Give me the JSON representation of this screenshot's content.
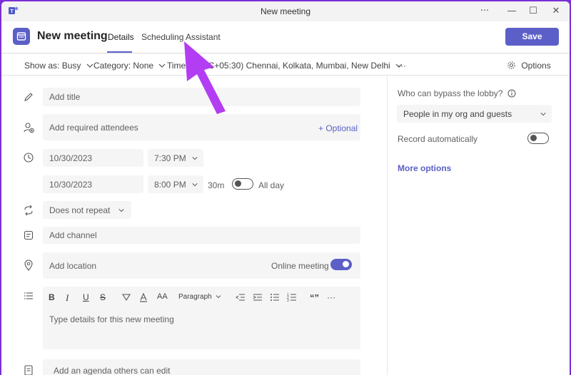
{
  "window": {
    "title": "New meeting",
    "controls": {
      "more": "···",
      "minimize": "—",
      "maximize": "☐",
      "close": "✕"
    }
  },
  "header": {
    "title": "New meeting",
    "tabs": [
      {
        "label": "Details",
        "active": true
      },
      {
        "label": "Scheduling Assistant",
        "active": false
      }
    ],
    "save_label": "Save"
  },
  "toolbar": {
    "show_as": "Show as: Busy",
    "category": "Category: None",
    "time_zone_prefix": "Time",
    "time_zone": "(UTC+05:30) Chennai, Kolkata, Mumbai, New Delhi",
    "more": "···",
    "options": "Options"
  },
  "form": {
    "title_placeholder": "Add title",
    "attendees_placeholder": "Add required attendees",
    "optional_link": "+ Optional",
    "start_date": "10/30/2023",
    "start_time": "7:30 PM",
    "end_date": "10/30/2023",
    "end_time": "8:00 PM",
    "duration": "30m",
    "all_day_label": "All day",
    "all_day_on": false,
    "repeat": "Does not repeat",
    "channel_placeholder": "Add channel",
    "location_placeholder": "Add location",
    "online_meeting_label": "Online meeting",
    "online_meeting_on": true,
    "paragraph_label": "Paragraph",
    "details_placeholder": "Type details for this new meeting",
    "agenda_placeholder": "Add an agenda others can edit"
  },
  "formatting": [
    "B",
    "I",
    "U",
    "S",
    "AA",
    "“”",
    "···"
  ],
  "side": {
    "lobby_label": "Who can bypass the lobby?",
    "lobby_value": "People in my org and guests",
    "record_label": "Record automatically",
    "record_on": false,
    "more_options": "More options"
  },
  "colors": {
    "accent": "#5b5fc7",
    "annotation_arrow": "#b33df2",
    "frame": "#7b2fd6"
  }
}
